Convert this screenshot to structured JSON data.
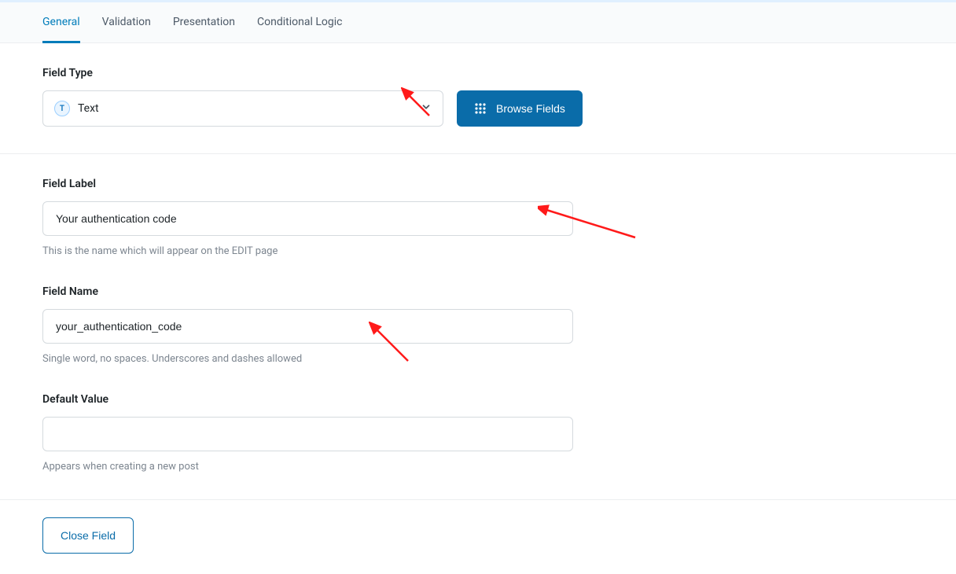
{
  "tabs": [
    {
      "label": "General",
      "active": true
    },
    {
      "label": "Validation",
      "active": false
    },
    {
      "label": "Presentation",
      "active": false
    },
    {
      "label": "Conditional Logic",
      "active": false
    }
  ],
  "field_type": {
    "label": "Field Type",
    "selected": "Text",
    "icon_glyph": "T",
    "browse_label": "Browse Fields"
  },
  "field_label": {
    "label": "Field Label",
    "value": "Your authentication code",
    "hint": "This is the name which will appear on the EDIT page"
  },
  "field_name": {
    "label": "Field Name",
    "value": "your_authentication_code",
    "hint": "Single word, no spaces. Underscores and dashes allowed"
  },
  "default_value": {
    "label": "Default Value",
    "value": "",
    "hint": "Appears when creating a new post"
  },
  "footer": {
    "close_label": "Close Field"
  },
  "annotation_arrow_color": "#ff1a1a"
}
